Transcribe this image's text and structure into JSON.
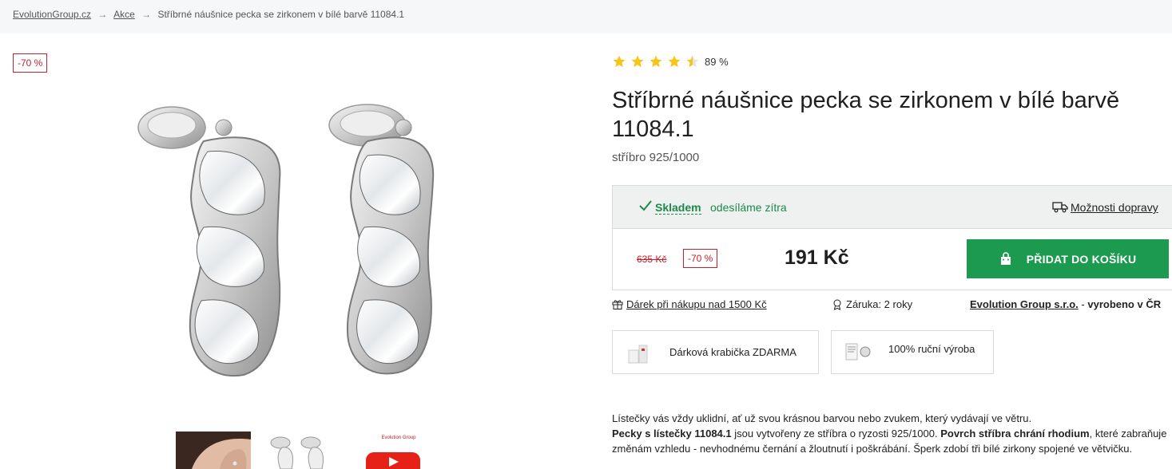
{
  "breadcrumb": {
    "home": "EvolutionGroup.cz",
    "sep1": "→",
    "category": "Akce",
    "sep2": "→",
    "current": "Stříbrné náušnice pecka se zirkonem v bílé barvě 11084.1"
  },
  "gallery": {
    "discount_badge": "-70 %",
    "thumbnails": [
      "model-ear-thumbnail",
      "earrings-thumbnail",
      "video-thumbnail"
    ],
    "video_logo_text": "Evolution Group"
  },
  "product": {
    "rating_stars": 4.5,
    "rating_text": "89 %",
    "title": "Stříbrné náušnice pecka se zirkonem v bílé barvě 11084.1",
    "subtitle": "stříbro 925/1000"
  },
  "stock": {
    "label": "Skladem",
    "note": "odesíláme zítra",
    "delivery_link": "Možnosti dopravy"
  },
  "pricing": {
    "old_price": "635 Kč",
    "discount": "-70 %",
    "price": "191 Kč",
    "cart_button": "PŘIDAT DO KOŠÍKU"
  },
  "info": {
    "gift": "Dárek při nákupu nad 1500 Kč",
    "warranty": "Záruka: 2 roky",
    "maker_link": "Evolution Group s.r.o.",
    "maker_dash": " - ",
    "maker_note": "vyrobeno v ČR"
  },
  "features": [
    {
      "text": "Dárková krabička ZDARMA"
    },
    {
      "text": "100% ruční výroba"
    }
  ],
  "description": {
    "line1": "Lístečky vás vždy uklidní, ať už svou krásnou barvou nebo zvukem, který vydávají ve větru.",
    "bold1": "Pecky s lístečky 11084.1",
    "text2": " jsou vytvořeny ze stříbra o ryzosti 925/1000. ",
    "bold2": "Povrch stříbra chrání rhodium",
    "text3": ", které zabraňuje změnám vzhledu - nevhodnému černání a žloutnutí i poškrábání. Šperk zdobí tři bílé zirkony spojené ve větvičku."
  },
  "colors": {
    "accent_green": "#1c9a4f",
    "discount_red": "#c8202a",
    "star_yellow": "#f5c518"
  }
}
